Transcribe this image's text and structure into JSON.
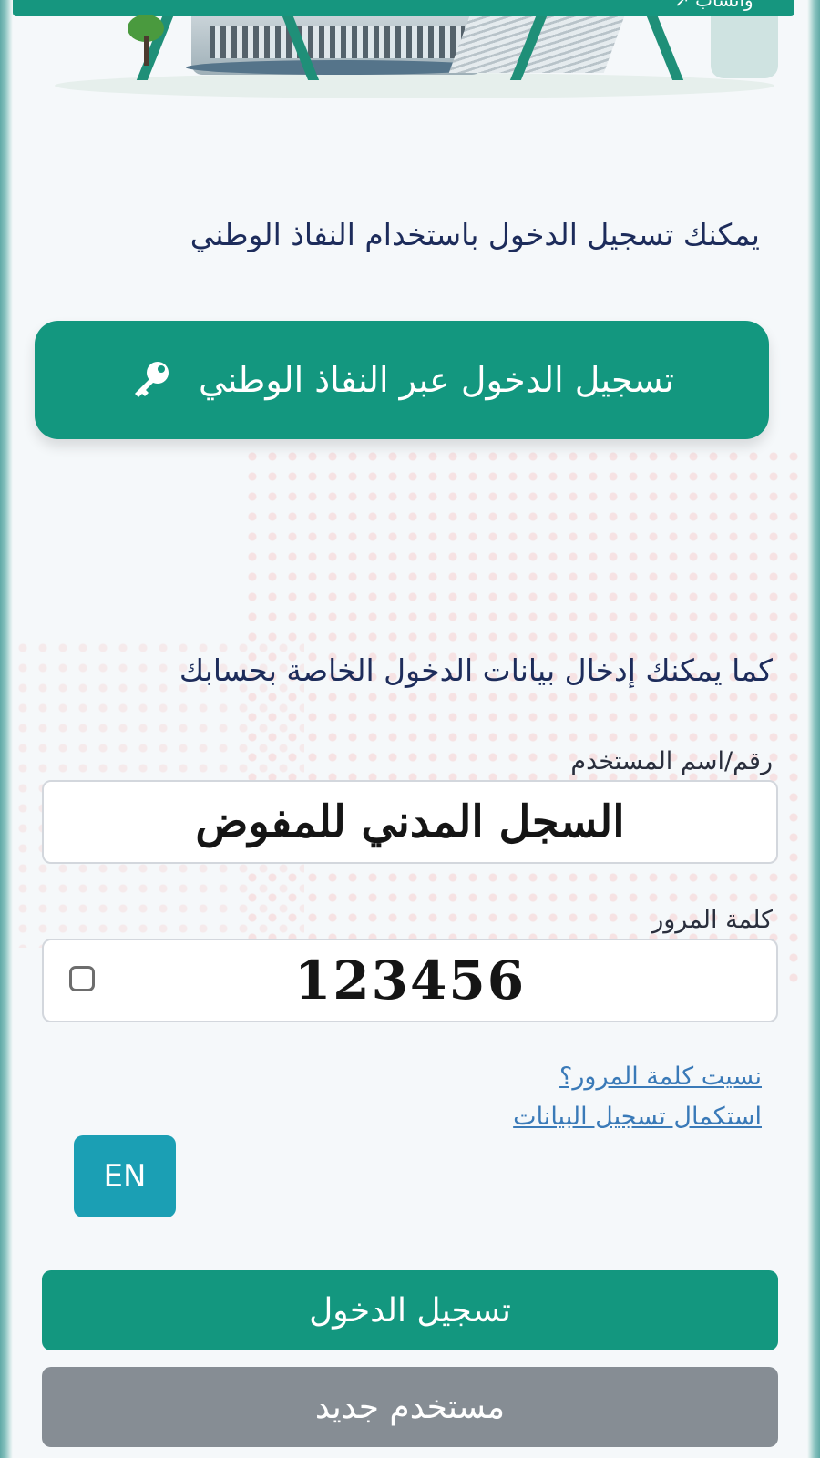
{
  "header": {
    "top_bar_text": "واتساب ↗"
  },
  "intro_text": "يمكنك تسجيل الدخول باستخدام النفاذ الوطني",
  "nafath_button": {
    "label": "تسجيل الدخول عبر النفاذ الوطني",
    "icon": "key-icon"
  },
  "secondary_intro": "كما يمكنك إدخال بيانات الدخول الخاصة بحسابك",
  "username": {
    "label": "رقم/اسم المستخدم",
    "value": "السجل المدني للمفوض"
  },
  "password": {
    "label": "كلمة المرور",
    "value": "123456"
  },
  "links": {
    "forgot_password": "نسيت كلمة المرور؟",
    "complete_registration": "استكمال تسجيل البيانات"
  },
  "language_button": "EN",
  "login_button": "تسجيل الدخول",
  "new_user_button": "مستخدم جديد",
  "colors": {
    "primary": "#13977f",
    "language": "#1b9fb4",
    "secondary": "#868d94",
    "heading": "#1d2c5b",
    "link": "#3a7ab8"
  }
}
